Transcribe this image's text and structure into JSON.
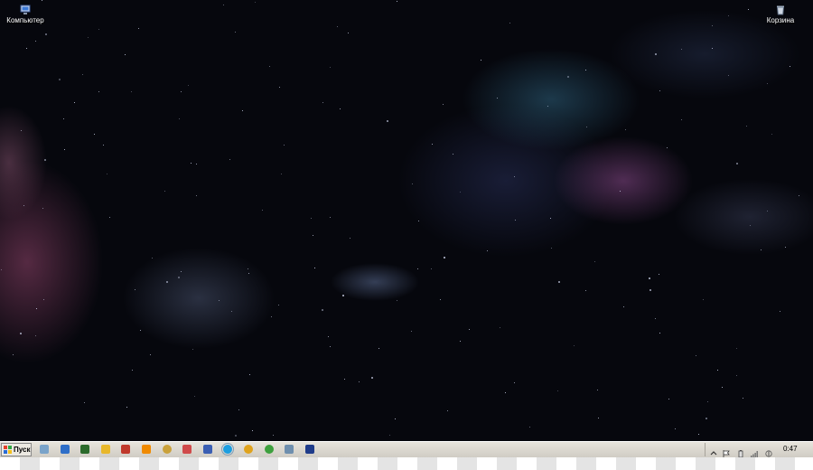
{
  "desktop": {
    "icons": [
      {
        "label": "Компьютер",
        "icon": "computer-icon"
      },
      {
        "label": "Корзина",
        "icon": "recycle-bin-icon"
      }
    ]
  },
  "taskbar": {
    "start_label": "Пуск",
    "quick_launch": [
      {
        "icon": "file-explorer-icon",
        "color": "#7aa3c9"
      },
      {
        "icon": "blue-app-icon",
        "color": "#2e6ec8"
      },
      {
        "icon": "terminal-icon",
        "color": "#2c6b2c"
      },
      {
        "icon": "flower-icon",
        "color": "#e8b72a"
      },
      {
        "icon": "shield-icon",
        "color": "#c0392b"
      },
      {
        "icon": "vlc-icon",
        "color": "#f08a00"
      },
      {
        "icon": "winamp-icon",
        "color": "#caa13a"
      },
      {
        "icon": "paint-icon",
        "color": "#d04a4a"
      },
      {
        "icon": "floppy-icon",
        "color": "#3b5fb3"
      },
      {
        "icon": "skype-icon",
        "color": "#1c9ee0"
      },
      {
        "icon": "chrome-icon",
        "color": "#e0a31c"
      },
      {
        "icon": "utorrent-icon",
        "color": "#3da03d"
      },
      {
        "icon": "scanner-icon",
        "color": "#6f8fae"
      },
      {
        "icon": "photoshop-icon",
        "color": "#1f3c8a"
      }
    ],
    "tray": {
      "icons": [
        "chevron-up-icon",
        "flag-icon",
        "battery-icon",
        "signal-icon",
        "volume-icon"
      ],
      "clock": "0:47"
    }
  }
}
